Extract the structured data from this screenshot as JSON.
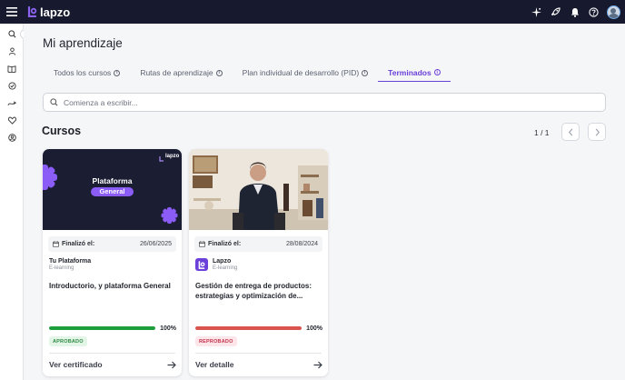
{
  "header": {
    "logo_text": "lapzo",
    "icons": [
      "menu-icon",
      "sparkle-icon",
      "rocket-icon",
      "bell-icon",
      "help-icon",
      "avatar"
    ]
  },
  "sidebar": {
    "icons": [
      "search-icon",
      "user-icon",
      "book-icon",
      "badge-check-icon",
      "route-icon",
      "heart-icon",
      "team-icon"
    ]
  },
  "page": {
    "title": "Mi aprendizaje"
  },
  "tabs": [
    {
      "label": "Todos los cursos",
      "active": false
    },
    {
      "label": "Rutas de aprendizaje",
      "active": false
    },
    {
      "label": "Plan individual de desarrollo (PID)",
      "active": false
    },
    {
      "label": "Terminados",
      "active": true
    }
  ],
  "search": {
    "placeholder": "Comienza a escribir..."
  },
  "section": {
    "title": "Cursos",
    "pager": "1 / 1"
  },
  "cards": [
    {
      "banner_title_1": "Plataforma",
      "banner_title_2": "General",
      "banner_logo": "lapzo",
      "finalized_label": "Finalizó el:",
      "finalized_date": "26/06/2025",
      "provider_name": "Tu Plataforma",
      "provider_type": "E-learning",
      "title": "Introductorio, y plataforma General",
      "progress": 100,
      "progress_label": "100%",
      "progress_color": "#1e9e3a",
      "status": "APROBADO",
      "status_bg": "#e3f5e6",
      "status_color": "#2f8a43",
      "action": "Ver certificado"
    },
    {
      "finalized_label": "Finalizó el:",
      "finalized_date": "28/08/2024",
      "provider_name": "Lapzo",
      "provider_type": "E-learning",
      "title": "Gestión de entrega de productos: estrategias y optimización de...",
      "progress": 100,
      "progress_label": "100%",
      "progress_color": "#d9534f",
      "status": "REPROBADO",
      "status_bg": "#fde6ea",
      "status_color": "#c2334a",
      "action": "Ver detalle"
    }
  ],
  "colors": {
    "accent": "#6b3fd9",
    "topbar": "#171a2e"
  }
}
